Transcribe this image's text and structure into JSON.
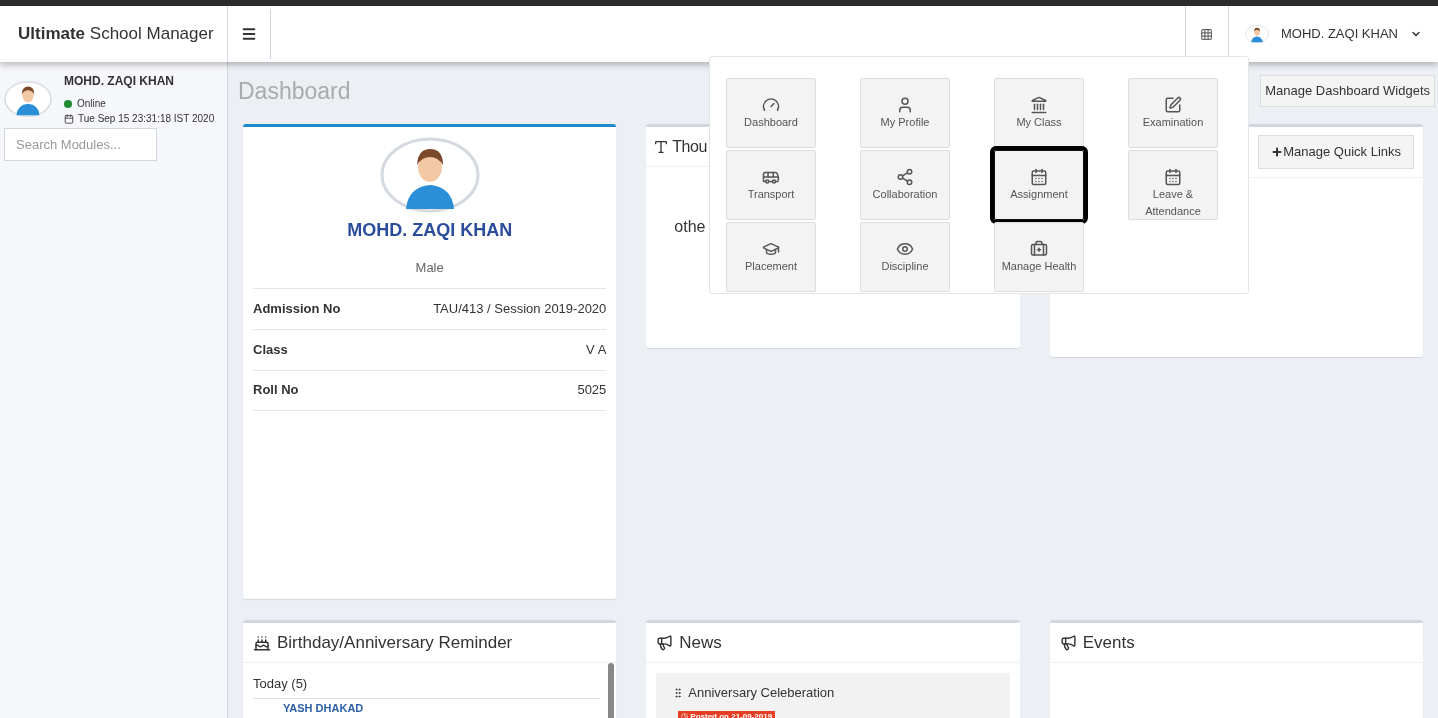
{
  "header": {
    "brand_bold": "Ultimate",
    "brand_rest": "School Manager",
    "user_name": "MOHD. ZAQI KHAN"
  },
  "sidebar": {
    "user_name": "MOHD. ZAQI KHAN",
    "status": "Online",
    "online": true,
    "datetime": "Tue Sep 15 23:31:18 IST 2020",
    "search": {
      "placeholder": "Search Modules..."
    }
  },
  "page_title": "Dashboard",
  "manage_widgets_button": "Manage Dashboard Widgets",
  "profile_card": {
    "name": "MOHD. ZAQI KHAN",
    "gender": "Male",
    "rows": [
      {
        "label": "Admission No",
        "value": "TAU/413 / Session 2019-2020"
      },
      {
        "label": "Class",
        "value": "V A"
      },
      {
        "label": "Roll No",
        "value": "5025"
      }
    ]
  },
  "thought_card": {
    "title": "Thou",
    "text": "othe"
  },
  "quick_links_card": {
    "button": "Manage Quick Links"
  },
  "birthday_card": {
    "title": "Birthday/Anniversary Reminder",
    "group": "Today (5)",
    "people": [
      {
        "name": "YASH DHAKAD"
      }
    ]
  },
  "news_card": {
    "title": "News",
    "items": [
      {
        "title": "Anniversary Celeberation",
        "badge": "Posted on 21-09-2019"
      }
    ]
  },
  "events_card": {
    "title": "Events"
  },
  "modules_menu": {
    "items": [
      {
        "label": "Dashboard",
        "selected": false
      },
      {
        "label": "My Profile",
        "selected": false
      },
      {
        "label": "My Class",
        "selected": false
      },
      {
        "label": "Examination",
        "selected": false
      },
      {
        "label": "Transport",
        "selected": false
      },
      {
        "label": "Collaboration",
        "selected": false
      },
      {
        "label": "Assignment",
        "selected": true
      },
      {
        "label": "Leave & Attendance",
        "selected": false
      },
      {
        "label": "Placement",
        "selected": false
      },
      {
        "label": "Discipline",
        "selected": false
      },
      {
        "label": "Manage Health",
        "selected": false
      }
    ]
  }
}
